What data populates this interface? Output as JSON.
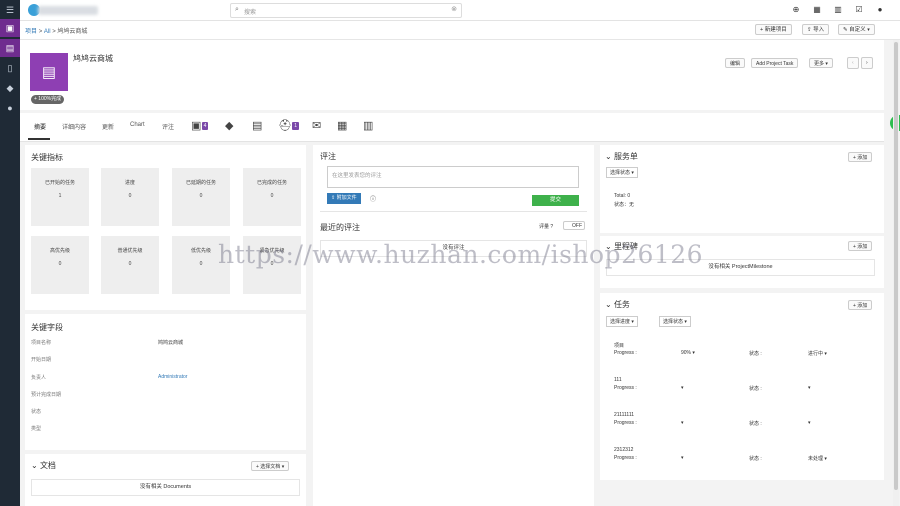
{
  "search": {
    "placeholder": "搜索"
  },
  "breadcrumb": {
    "home": "项目",
    "sep1": ">",
    "all": "All",
    "sep2": ">",
    "current": "鸠鸠云商城"
  },
  "actions": {
    "new_project": "+ 新建项目",
    "import": "导入",
    "customize": "自定义"
  },
  "project": {
    "name": "鸠鸠云商城",
    "progress_badge": "+ 100%完成",
    "btn_edit": "编辑",
    "btn_add_task": "Add Project Task",
    "btn_more": "更多"
  },
  "tabs": {
    "summary": "摘要",
    "details": "详细内容",
    "updates": "更新",
    "chart": "Chart",
    "comments": "评注",
    "tasks_count": "4",
    "helpdesk_count": "1"
  },
  "key_metrics": {
    "title": "关键指标",
    "items": [
      {
        "label": "已开始的任务",
        "value": "1"
      },
      {
        "label": "进度",
        "value": "0"
      },
      {
        "label": "已延期的任务",
        "value": "0"
      },
      {
        "label": "已完成的任务",
        "value": "0"
      },
      {
        "label": "高优先级",
        "value": "0"
      },
      {
        "label": "普通优先级",
        "value": "0"
      },
      {
        "label": "低优先级",
        "value": "0"
      },
      {
        "label": "紧急优先级",
        "value": "0"
      }
    ]
  },
  "key_fields": {
    "title": "关键字段",
    "rows": [
      {
        "label": "项目名称",
        "value": "鸠鸠云商城"
      },
      {
        "label": "开始日期",
        "value": ""
      },
      {
        "label": "负责人",
        "value": "Administrator"
      },
      {
        "label": "预计完成日期",
        "value": ""
      },
      {
        "label": "状态",
        "value": ""
      },
      {
        "label": "类型",
        "value": ""
      }
    ]
  },
  "documents": {
    "title": "文档",
    "select_btn": "+ 选择文档",
    "empty": "没有相关 Documents"
  },
  "comments_panel": {
    "title": "评注",
    "placeholder": "在这里发表您的评注",
    "attach_btn": "附加文件",
    "submit_btn": "提交",
    "recent_title": "最近的评注",
    "rich_text_label": "评量",
    "toggle_label": "OFF",
    "empty": "没有评注"
  },
  "service_orders": {
    "title": "服务单",
    "add_btn": "+ 添加",
    "status_select": "选择状态",
    "total": "Total: 0",
    "status_note": "状态：无"
  },
  "milestones": {
    "title": "里程碑",
    "add_btn": "+ 添加",
    "empty": "没有相关 ProjectMilestone"
  },
  "tasks": {
    "title": "任务",
    "add_btn": "+ 添加",
    "filter_progress": "选择进度",
    "filter_status": "选择状态",
    "items": [
      {
        "name": "项目",
        "progress_label": "Progress :",
        "progress": "90%",
        "status_label": "状态 :",
        "status": "进行中"
      },
      {
        "name": "111",
        "progress_label": "Progress :",
        "progress": "",
        "status_label": "状态 :",
        "status": ""
      },
      {
        "name": "21111111",
        "progress_label": "Progress :",
        "progress": "",
        "status_label": "状态 :",
        "status": ""
      },
      {
        "name": "2312312",
        "progress_label": "Progress :",
        "progress": "",
        "status_label": "状态 :",
        "status": "未处理"
      }
    ]
  },
  "watermark": "https://www.huzhan.com/ishop26126",
  "colors": {
    "sidebar": "#1f2a36",
    "accent_purple": "#8e3fb3",
    "submit_green": "#3eb14b",
    "attach_blue": "#337ab7",
    "float_green": "#2dbd4f"
  }
}
